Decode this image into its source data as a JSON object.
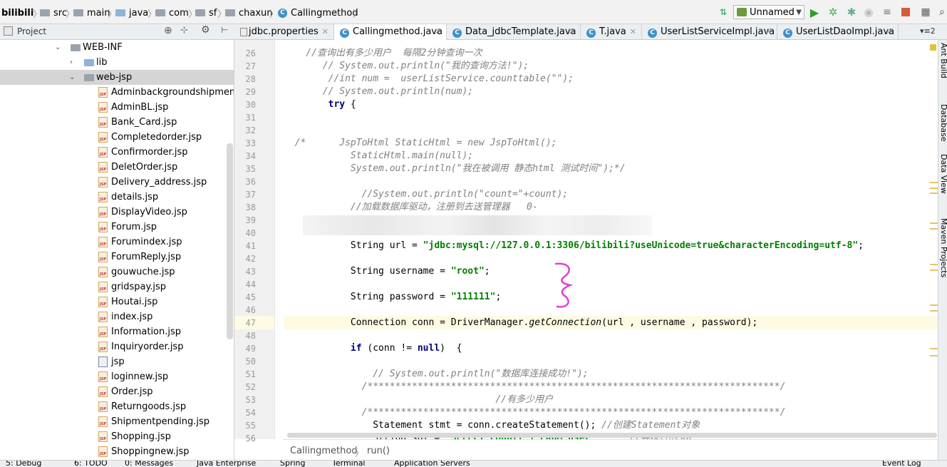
{
  "navbar": {
    "crumbs": [
      "bilibili",
      "src",
      "main",
      "java",
      "com",
      "sf",
      "chaxun",
      "Callingmethod"
    ],
    "run_config": "Unnamed"
  },
  "project_panel": {
    "title": "Project",
    "tree": [
      {
        "label": "WEB-INF",
        "type": "folder",
        "expanded": true
      },
      {
        "label": "lib",
        "type": "folder",
        "expanded": false
      },
      {
        "label": "web-jsp",
        "type": "folder",
        "expanded": true,
        "selected": true
      },
      {
        "label": "Adminbackgroundshipment.js",
        "type": "jsp"
      },
      {
        "label": "AdminBL.jsp",
        "type": "jsp"
      },
      {
        "label": "Bank_Card.jsp",
        "type": "jsp"
      },
      {
        "label": "Completedorder.jsp",
        "type": "jsp"
      },
      {
        "label": "Confirmorder.jsp",
        "type": "jsp"
      },
      {
        "label": "DeletOrder.jsp",
        "type": "jsp"
      },
      {
        "label": "Delivery_address.jsp",
        "type": "jsp"
      },
      {
        "label": "details.jsp",
        "type": "jsp"
      },
      {
        "label": "DisplayVideo.jsp",
        "type": "jsp"
      },
      {
        "label": "Forum.jsp",
        "type": "jsp"
      },
      {
        "label": "Forumindex.jsp",
        "type": "jsp"
      },
      {
        "label": "ForumReply.jsp",
        "type": "jsp"
      },
      {
        "label": "gouwuche.jsp",
        "type": "jsp"
      },
      {
        "label": "gridspay.jsp",
        "type": "jsp"
      },
      {
        "label": "Houtai.jsp",
        "type": "jsp"
      },
      {
        "label": "index.jsp",
        "type": "jsp"
      },
      {
        "label": "Information.jsp",
        "type": "jsp"
      },
      {
        "label": "Inquiryorder.jsp",
        "type": "jsp"
      },
      {
        "label": "jsp",
        "type": "file"
      },
      {
        "label": "loginnew.jsp",
        "type": "jsp"
      },
      {
        "label": "Order.jsp",
        "type": "jsp"
      },
      {
        "label": "Returngoods.jsp",
        "type": "jsp"
      },
      {
        "label": "Shipmentpending.jsp",
        "type": "jsp"
      },
      {
        "label": "Shopping.jsp",
        "type": "jsp"
      },
      {
        "label": "Shoppingnew.jsp",
        "type": "jsp"
      }
    ]
  },
  "tabs": [
    {
      "label": "jdbc.properties",
      "active": false
    },
    {
      "label": "Callingmethod.java",
      "active": true
    },
    {
      "label": "Data_jdbcTemplate.java",
      "active": false
    },
    {
      "label": "T.java",
      "active": false
    },
    {
      "label": "UserListServiceImpl.java",
      "active": false
    },
    {
      "label": "UserListDaoImpl.java",
      "active": false
    }
  ],
  "tab_overflow": "2",
  "editor": {
    "line_numbers": [
      "26",
      "27",
      "28",
      "29",
      "30",
      "31",
      "32",
      "33",
      "34",
      "35",
      "36",
      "37",
      "38",
      "39",
      "40",
      "41",
      "42",
      "43",
      "44",
      "45",
      "46",
      "47",
      "48",
      "49",
      "50",
      "51",
      "52",
      "53",
      "54",
      "55",
      "56"
    ],
    "lines": [
      "    //查询出有多少用户  每隔2分钟查询一次",
      "       // System.out.println(\"我的查询方法!\");",
      "        //int num =  userListService.counttable(\"\");",
      "       // System.out.println(num);",
      "        try {",
      "",
      "",
      "  /*      JspToHtml StaticHtml = new JspToHtml();",
      "            StaticHtml.main(null);",
      "            System.out.println(\"我在被调用 静态html 测试时间\");*/",
      "",
      "              //System.out.println(\"count=\"+count);",
      "            //加载数据库驱动，注册到去送管理器   0-",
      "",
      "",
      "            String url = \"jdbc:mysql://127.0.0.1:3306/bilibili?useUnicode=true&characterEncoding=utf-8\";",
      "",
      "            String username = \"root\";",
      "",
      "            String password = \"111111\";",
      "",
      "            Connection conn = DriverManager.getConnection(url , username , password);",
      "",
      "            if (conn != null)  {",
      "",
      "                // System.out.println(\"数据库连接成功!\");",
      "              /**************************************************************************/",
      "                                      //有多少用户",
      "              /**************************************************************************/",
      "                Statement stmt = conn.createStatement(); //创建Statement对象",
      "                String sql = \"SELECT count(*) FROM user\";     //要执行的SQL"
    ]
  },
  "breadcrumb": {
    "class": "Callingmethod",
    "method": "run()"
  },
  "right_strip": [
    "Ant Build",
    "Database",
    "Data View",
    "Maven Projects"
  ],
  "bottom_tabs": [
    "5: Debug",
    "6: TODO",
    "0: Messages",
    "Java Enterprise",
    "Spring",
    "Terminal",
    "Application Servers",
    "Event Log"
  ]
}
